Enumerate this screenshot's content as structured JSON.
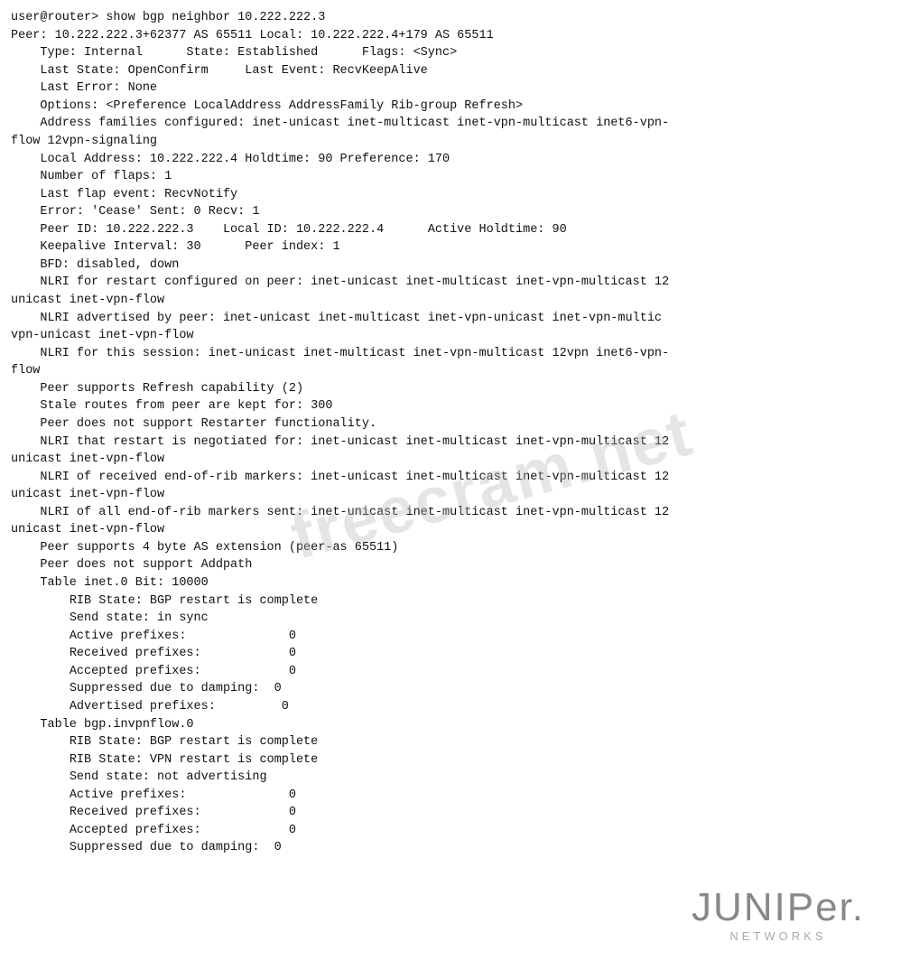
{
  "terminal": {
    "lines": [
      "user@router> show bgp neighbor 10.222.222.3",
      "Peer: 10.222.222.3+62377 AS 65511 Local: 10.222.222.4+179 AS 65511",
      "    Type: Internal      State: Established      Flags: <Sync>",
      "    Last State: OpenConfirm     Last Event: RecvKeepAlive",
      "    Last Error: None",
      "    Options: <Preference LocalAddress AddressFamily Rib-group Refresh>",
      "    Address families configured: inet-unicast inet-multicast inet-vpn-multicast inet6-vpn-",
      "flow 12vpn-signaling",
      "    Local Address: 10.222.222.4 Holdtime: 90 Preference: 170",
      "    Number of flaps: 1",
      "    Last flap event: RecvNotify",
      "    Error: 'Cease' Sent: 0 Recv: 1",
      "    Peer ID: 10.222.222.3    Local ID: 10.222.222.4      Active Holdtime: 90",
      "    Keepalive Interval: 30      Peer index: 1",
      "    BFD: disabled, down",
      "    NLRI for restart configured on peer: inet-unicast inet-multicast inet-vpn-multicast 12",
      "unicast inet-vpn-flow",
      "    NLRI advertised by peer: inet-unicast inet-multicast inet-vpn-unicast inet-vpn-multic",
      "vpn-unicast inet-vpn-flow",
      "    NLRI for this session: inet-unicast inet-multicast inet-vpn-multicast 12vpn inet6-vpn-",
      "flow",
      "    Peer supports Refresh capability (2)",
      "    Stale routes from peer are kept for: 300",
      "    Peer does not support Restarter functionality.",
      "    NLRI that restart is negotiated for: inet-unicast inet-multicast inet-vpn-multicast 12",
      "unicast inet-vpn-flow",
      "    NLRI of received end-of-rib markers: inet-unicast inet-multicast inet-vpn-multicast 12",
      "unicast inet-vpn-flow",
      "    NLRI of all end-of-rib markers sent: inet-unicast inet-multicast inet-vpn-multicast 12",
      "unicast inet-vpn-flow",
      "    Peer supports 4 byte AS extension (peer-as 65511)",
      "    Peer does not support Addpath",
      "    Table inet.0 Bit: 10000",
      "        RIB State: BGP restart is complete",
      "        Send state: in sync",
      "        Active prefixes:              0",
      "        Received prefixes:            0",
      "        Accepted prefixes:            0",
      "        Suppressed due to damping:  0",
      "        Advertised prefixes:         0",
      "    Table bgp.invpnflow.0",
      "        RIB State: BGP restart is complete",
      "        RIB State: VPN restart is complete",
      "        Send state: not advertising",
      "        Active prefixes:              0",
      "        Received prefixes:            0",
      "        Accepted prefixes:            0",
      "        Suppressed due to damping:  0"
    ]
  },
  "watermark": {
    "text": "freecram.net"
  },
  "logo": {
    "name": "JUNIPer.",
    "networks": "NETWORKS"
  }
}
